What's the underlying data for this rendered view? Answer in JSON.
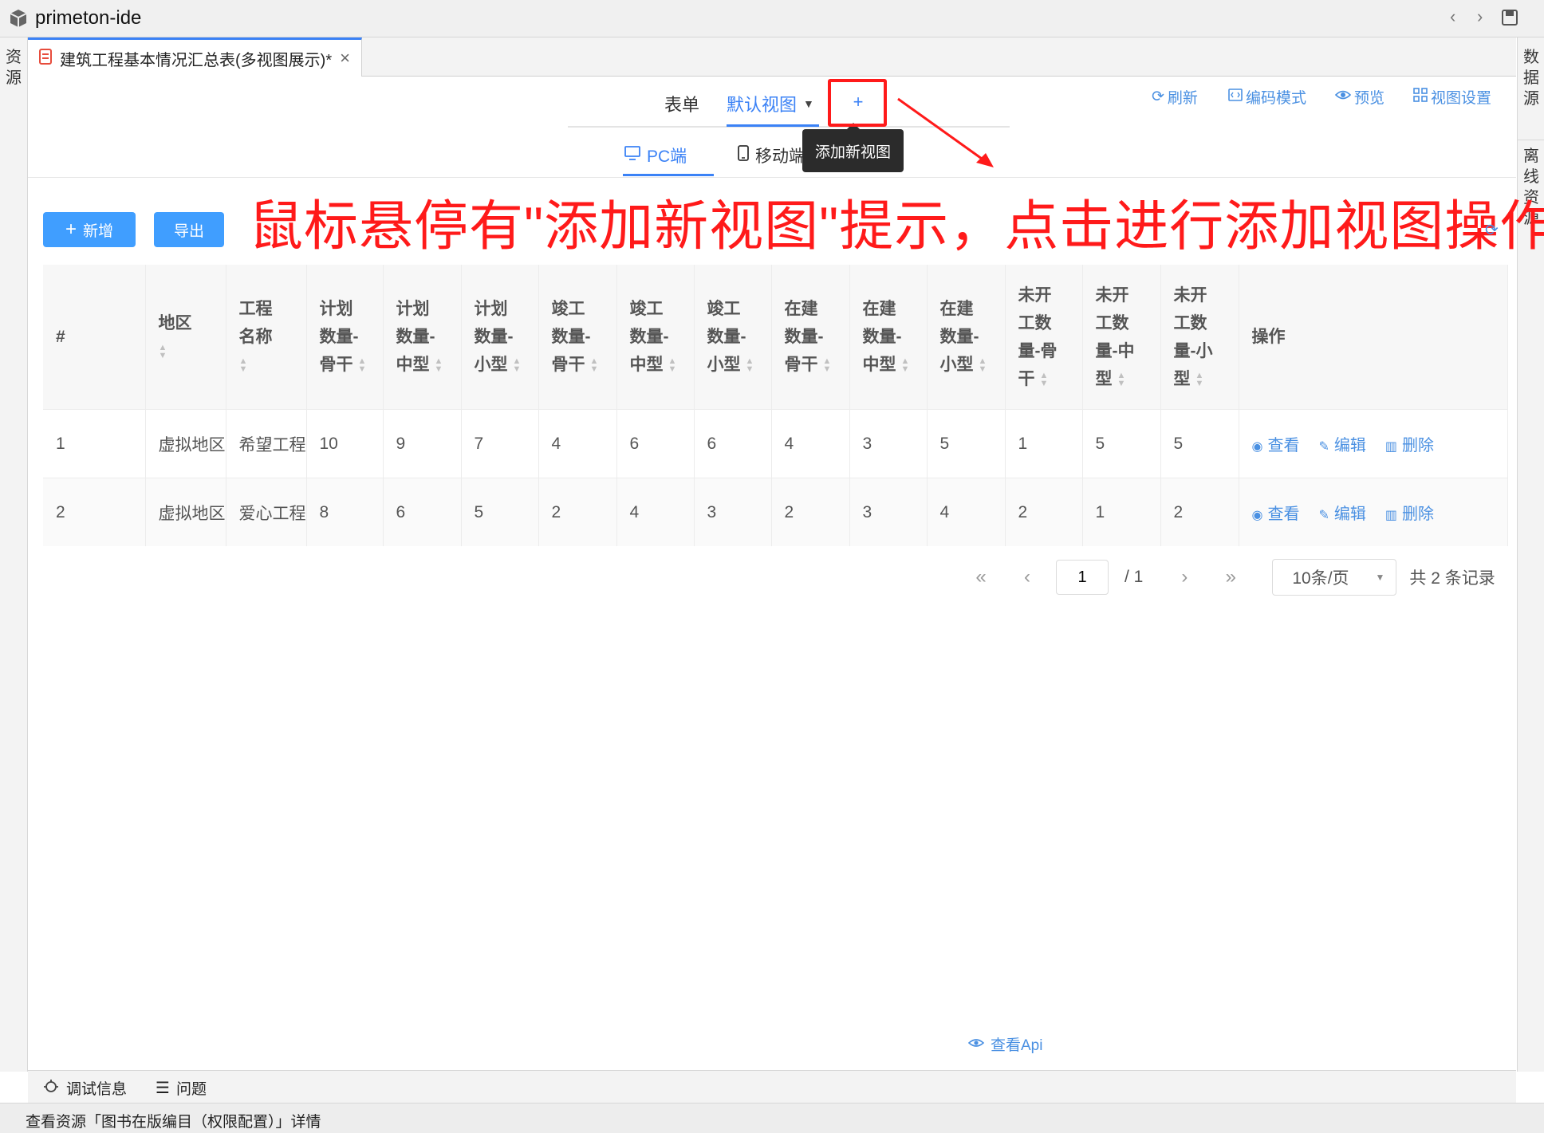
{
  "app": {
    "title": "primeton-ide"
  },
  "left_rail": {
    "label": "资源"
  },
  "right_rail": {
    "data_source": "数据源",
    "offline_resource": "离线资源"
  },
  "editor_tab": {
    "label": "建筑工程基本情况汇总表(多视图展示)*"
  },
  "view_tabs": {
    "form": "表单",
    "default_view": "默认视图",
    "add": "+"
  },
  "tooltip": "添加新视图",
  "toolbar": {
    "refresh": "刷新",
    "code_mode": "编码模式",
    "preview": "预览",
    "view_settings": "视图设置"
  },
  "device_tabs": {
    "pc": "PC端",
    "mobile": "移动端"
  },
  "annotation": "鼠标悬停有\"添加新视图\"提示，点击进行添加视图操作",
  "buttons": {
    "add": "新增",
    "export": "导出"
  },
  "table": {
    "columns": [
      {
        "lines": [
          "#"
        ],
        "sortable": false,
        "width": 128
      },
      {
        "lines": [
          "地区"
        ],
        "sortable": true,
        "width": 96
      },
      {
        "lines": [
          "工程",
          "名称"
        ],
        "sortable": true,
        "width": 96
      },
      {
        "lines": [
          "计划",
          "数量-",
          "骨干"
        ],
        "sortable": true,
        "width": 96
      },
      {
        "lines": [
          "计划",
          "数量-",
          "中型"
        ],
        "sortable": true,
        "width": 98
      },
      {
        "lines": [
          "计划",
          "数量-",
          "小型"
        ],
        "sortable": true,
        "width": 97
      },
      {
        "lines": [
          "竣工",
          "数量-",
          "骨干"
        ],
        "sortable": true,
        "width": 98
      },
      {
        "lines": [
          "竣工",
          "数量-",
          "中型"
        ],
        "sortable": true,
        "width": 97
      },
      {
        "lines": [
          "竣工",
          "数量-",
          "小型"
        ],
        "sortable": true,
        "width": 97
      },
      {
        "lines": [
          "在建",
          "数量-",
          "骨干"
        ],
        "sortable": true,
        "width": 98
      },
      {
        "lines": [
          "在建",
          "数量-",
          "中型"
        ],
        "sortable": true,
        "width": 97
      },
      {
        "lines": [
          "在建",
          "数量-",
          "小型"
        ],
        "sortable": true,
        "width": 98
      },
      {
        "lines": [
          "未开",
          "工数",
          "量-骨",
          "干"
        ],
        "sortable": true,
        "width": 97
      },
      {
        "lines": [
          "未开",
          "工数",
          "量-中",
          "型"
        ],
        "sortable": true,
        "width": 98
      },
      {
        "lines": [
          "未开",
          "工数",
          "量-小",
          "型"
        ],
        "sortable": true,
        "width": 98
      },
      {
        "lines": [
          "操作"
        ],
        "sortable": false,
        "width": 337
      }
    ],
    "rows": [
      [
        "1",
        "虚拟地区",
        "希望工程",
        "10",
        "9",
        "7",
        "4",
        "6",
        "6",
        "4",
        "3",
        "5",
        "1",
        "5",
        "5"
      ],
      [
        "2",
        "虚拟地区",
        "爱心工程",
        "8",
        "6",
        "5",
        "2",
        "4",
        "3",
        "2",
        "3",
        "4",
        "2",
        "1",
        "2"
      ]
    ],
    "row_actions": {
      "view": "查看",
      "edit": "编辑",
      "delete": "删除"
    }
  },
  "pagination": {
    "current_page": "1",
    "total_pages": "/ 1",
    "page_size": "10条/页",
    "total_records": "共 2 条记录"
  },
  "view_api": "查看Api",
  "bottom_tabs": {
    "debug": "调试信息",
    "problems": "问题"
  },
  "status_bar": "查看资源「图书在版编目（权限配置）」详情",
  "colors": {
    "accent": "#409eff",
    "annotation": "#ff1a1a",
    "tooltip_bg": "#2b2b2b"
  }
}
